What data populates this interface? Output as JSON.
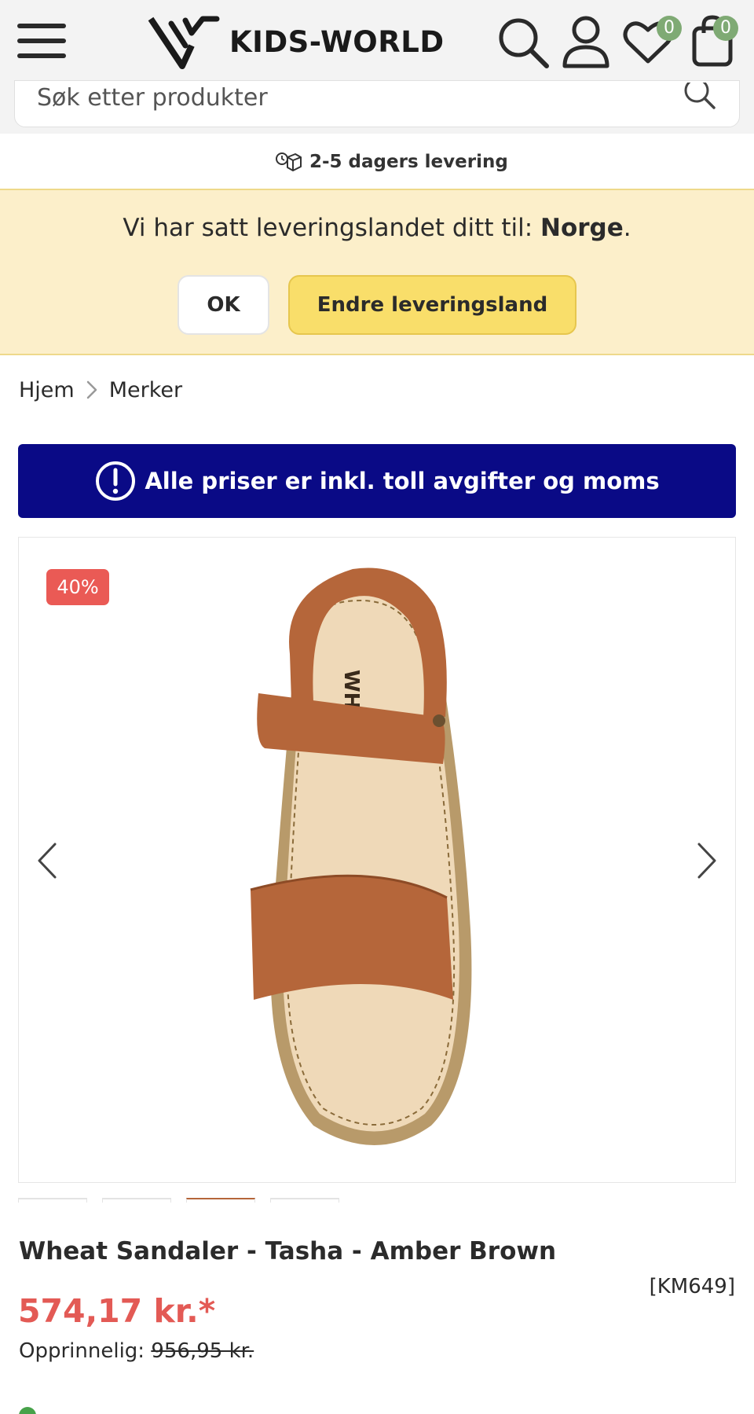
{
  "header": {
    "logo_text": "KIDS-WORLD",
    "wishlist_count": "0",
    "cart_count": "0",
    "badge_color": "#7faa74"
  },
  "search": {
    "placeholder": "Søk etter produkter"
  },
  "delivery": {
    "text": "2-5 dagers levering"
  },
  "country_banner": {
    "message_prefix": "Vi har satt leveringslandet ditt til: ",
    "country": "Norge",
    "message_suffix": ".",
    "ok_label": "OK",
    "change_label": "Endre leveringsland",
    "background": "#fcefca",
    "accent": "#f9de6a"
  },
  "breadcrumb": {
    "items": [
      "Hjem",
      "Merker"
    ]
  },
  "info_banner": {
    "text": "Alle priser er inkl. toll avgifter og moms",
    "background": "#0a0a86"
  },
  "gallery": {
    "discount_badge": "40%",
    "image_alt": "Wheat Sandaler - Tasha - Amber Brown",
    "sandal_print": "WHEAT"
  },
  "product": {
    "title": "Wheat Sandaler - Tasha - Amber Brown",
    "sku": "[KM649]",
    "price": "574,17 kr.*",
    "original_label": "Opprinnelig: ",
    "original_price": "956,95 kr.",
    "price_color": "#e35a55"
  }
}
